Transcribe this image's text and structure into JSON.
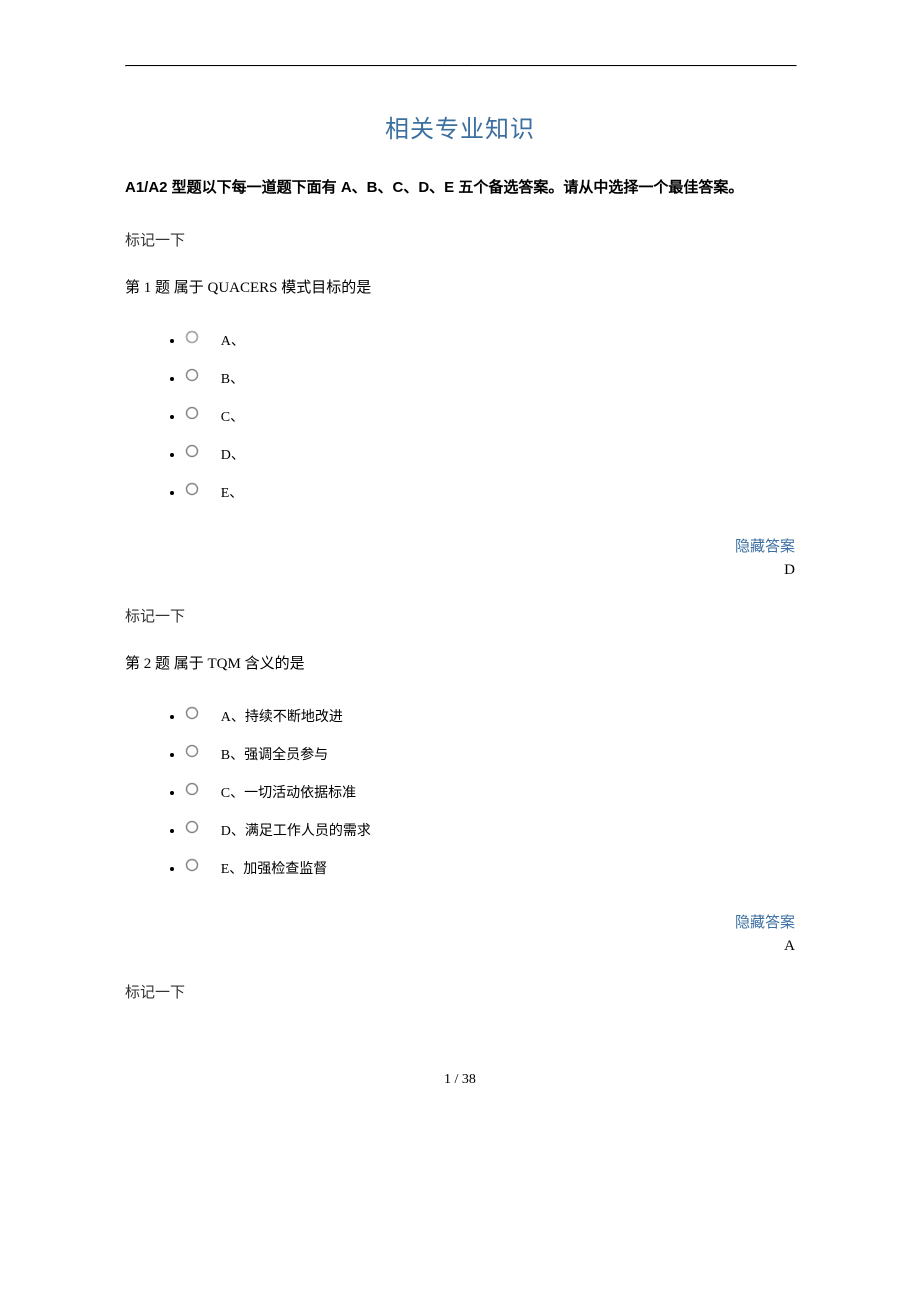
{
  "top_marker": ".   .",
  "title": "相关专业知识",
  "instruction": "A1/A2 型题以下每一道题下面有 A、B、C、D、E 五个备选答案。请从中选择一个最佳答案。",
  "mark_text": "标记一下",
  "hide_answer_label": "隐藏答案",
  "questions": [
    {
      "stem": "第 1 题 属于 QUACERS 模式目标的是",
      "options": [
        {
          "label": "A、"
        },
        {
          "label": "B、"
        },
        {
          "label": "C、"
        },
        {
          "label": "D、"
        },
        {
          "label": "E、"
        }
      ],
      "answer": "D"
    },
    {
      "stem": "第 2 题 属于 TQM 含义的是",
      "options": [
        {
          "label": "A、持续不断地改进"
        },
        {
          "label": "B、强调全员参与"
        },
        {
          "label": "C、一切活动依据标准"
        },
        {
          "label": "D、满足工作人员的需求"
        },
        {
          "label": "E、加强检查监督"
        }
      ],
      "answer": "A"
    }
  ],
  "q3_mark": "标记一下",
  "footer": "1 / 38"
}
